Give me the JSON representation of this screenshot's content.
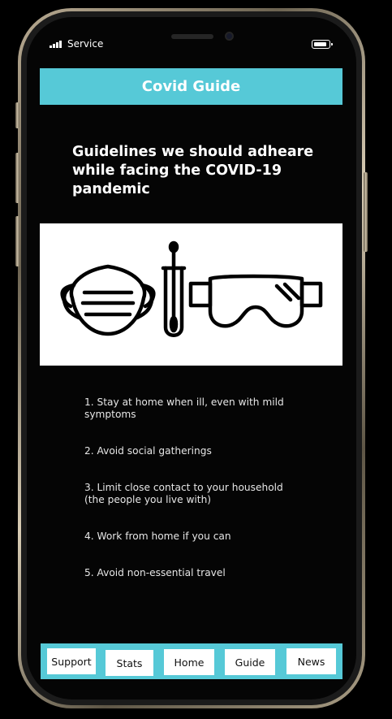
{
  "status_bar": {
    "carrier": "Service",
    "signal_icon": "signal-bars-icon",
    "battery_icon": "battery-icon"
  },
  "app": {
    "title": "Covid Guide",
    "accent_color": "#56c9d7"
  },
  "headline": "Guidelines we should adheare while facing the COVID-19 pandemic",
  "illustration": {
    "icons": [
      "face-mask-icon",
      "test-swab-icon",
      "safety-goggles-icon"
    ]
  },
  "guidelines": [
    "1. Stay at home when ill, even with mild symptoms",
    "2. Avoid social gatherings",
    "3. Limit close contact to your household (the people you live with)",
    "4. Work from home if you can",
    "5. Avoid non-essential travel"
  ],
  "bottom_nav": [
    "Support",
    "Stats",
    "Home",
    "Guide",
    "News"
  ]
}
